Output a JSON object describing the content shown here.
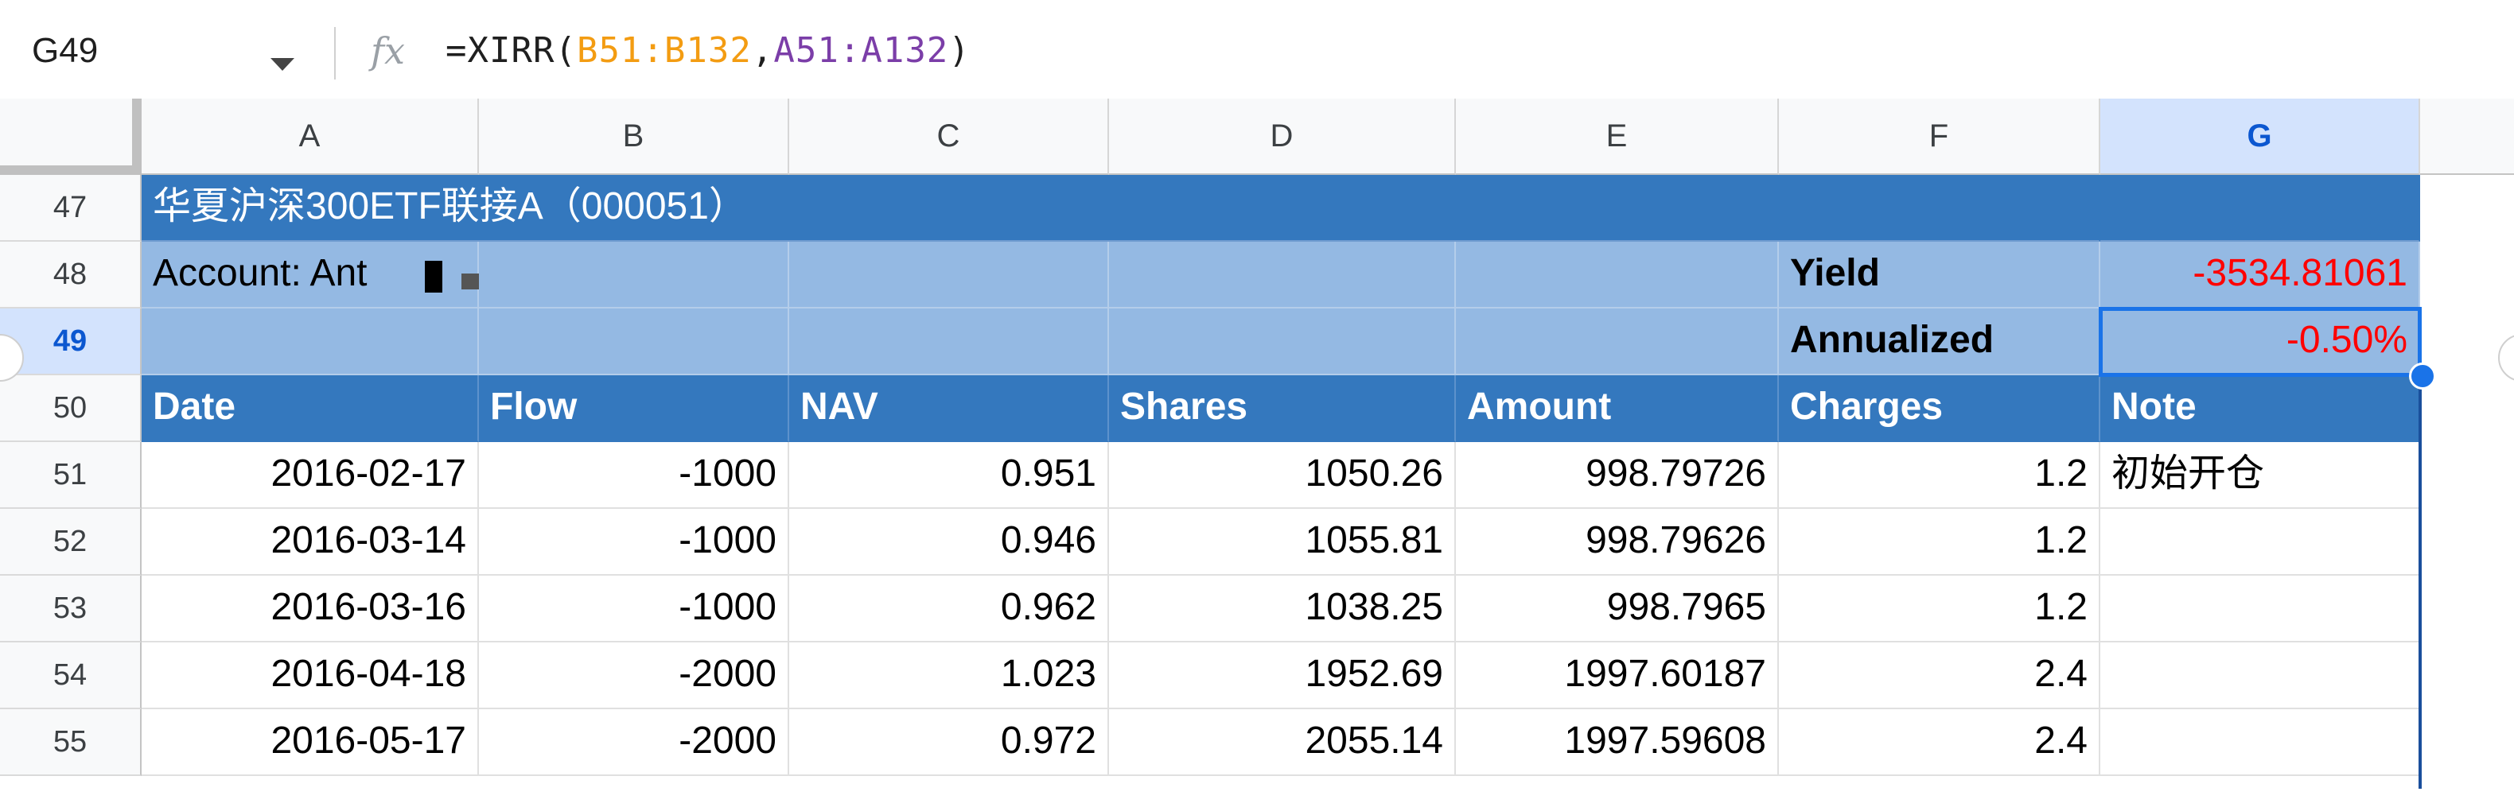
{
  "formula_bar": {
    "name_box": "G49",
    "formula_prefix": "=XIRR(",
    "formula_ref1": "B51:B132",
    "formula_sep": ",",
    "formula_ref2": "A51:A132",
    "formula_suffix": ")"
  },
  "columns": [
    "A",
    "B",
    "C",
    "D",
    "E",
    "F",
    "G"
  ],
  "selected_column": "G",
  "rows": [
    "47",
    "48",
    "49",
    "50",
    "51",
    "52",
    "53",
    "54",
    "55"
  ],
  "selected_row": "49",
  "sheet": {
    "fund_title": "华夏沪深300ETF联接A（000051）",
    "account_label": "Account: Ant",
    "yield_label": "Yield",
    "yield_value": "-3534.81061",
    "annualized_label": "Annualized",
    "annualized_value": "-0.50%",
    "headers": [
      "Date",
      "Flow",
      "NAV",
      "Shares",
      "Amount",
      "Charges",
      "Note"
    ],
    "data_rows": [
      [
        "2016-02-17",
        "-1000",
        "0.951",
        "1050.26",
        "998.79726",
        "1.2",
        "初始开仓"
      ],
      [
        "2016-03-14",
        "-1000",
        "0.946",
        "1055.81",
        "998.79626",
        "1.2",
        ""
      ],
      [
        "2016-03-16",
        "-1000",
        "0.962",
        "1038.25",
        "998.7965",
        "1.2",
        ""
      ],
      [
        "2016-04-18",
        "-2000",
        "1.023",
        "1952.69",
        "1997.60187",
        "2.4",
        ""
      ],
      [
        "2016-05-17",
        "-2000",
        "0.972",
        "2055.14",
        "1997.59608",
        "2.4",
        ""
      ]
    ]
  },
  "colors": {
    "header_blue": "#3478be",
    "light_blue": "#94b9e3",
    "selection_blue": "#1a73e8",
    "negative_red": "#ff0000"
  }
}
